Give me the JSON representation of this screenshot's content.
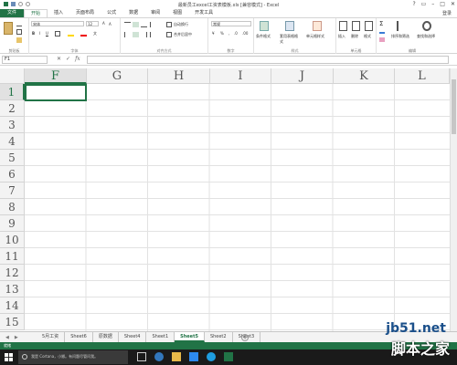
{
  "window": {
    "title": "最新员工excel工资表模板.xls [兼容模式] - Excel",
    "signin": "登录"
  },
  "tabs": [
    "文件",
    "开始",
    "插入",
    "页面布局",
    "公式",
    "数据",
    "审阅",
    "视图",
    "开发工具"
  ],
  "ribbon": {
    "clipboard_label": "剪贴板",
    "font_label": "字体",
    "font_name": "宋体",
    "font_size": "12",
    "align_label": "对齐方式",
    "wrap_text": "自动换行",
    "merge_center": "合并后居中",
    "number_label": "数字",
    "number_format": "常规",
    "styles_label": "样式",
    "cond_format": "条件格式",
    "table_format": "套用表格格式",
    "cell_styles": "单元格样式",
    "cells_label": "单元格",
    "insert": "插入",
    "delete": "删除",
    "format": "格式",
    "editing_label": "编辑",
    "sort_filter": "排序和筛选",
    "find_select": "查找和选择"
  },
  "formula_bar": {
    "name_box": "F1",
    "formula": ""
  },
  "grid": {
    "columns": [
      "F",
      "G",
      "H",
      "I",
      "J",
      "K",
      "L"
    ],
    "rows": [
      "1",
      "2",
      "3",
      "4",
      "5",
      "6",
      "7",
      "8",
      "9",
      "10",
      "11",
      "12",
      "13",
      "14",
      "15"
    ],
    "selected_column": "F",
    "selected_row": "1"
  },
  "sheets": [
    "5月工资",
    "Sheet6",
    "原数据",
    "Sheet4",
    "Sheet1",
    "Sheet5",
    "Sheet2",
    "Sheet3"
  ],
  "active_sheet": "Sheet5",
  "status": "就绪",
  "taskbar": {
    "cortana_text": "我是 Cortana，小娜。有问题尽管问我。"
  },
  "watermark": {
    "site": "jb51.net",
    "name": "脚本之家"
  },
  "colors": {
    "accent": "#217346",
    "taskbar": "#1a1a1a"
  }
}
